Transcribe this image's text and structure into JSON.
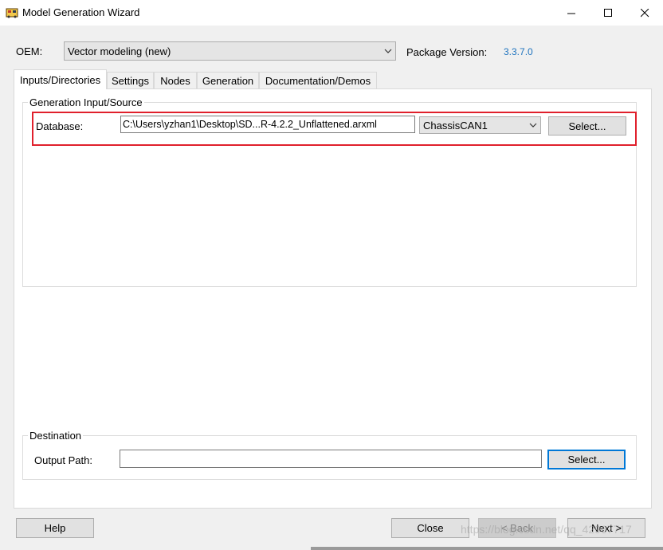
{
  "window": {
    "title": "Model Generation Wizard",
    "minimize_glyph": "—",
    "maximize_glyph": "☐",
    "close_glyph": "✕"
  },
  "oem": {
    "label": "OEM:",
    "value": "Vector modeling (new)",
    "package_version_label": "Package Version:",
    "package_version_value": "3.3.7.0"
  },
  "tabs": [
    {
      "label": "Inputs/Directories",
      "active": true
    },
    {
      "label": "Settings",
      "active": false
    },
    {
      "label": "Nodes",
      "active": false
    },
    {
      "label": "Generation",
      "active": false
    },
    {
      "label": "Documentation/Demos",
      "active": false
    }
  ],
  "generation_input": {
    "group_label": "Generation Input/Source",
    "database_label": "Database:",
    "database_path": "C:\\Users\\yzhan1\\Desktop\\SD...R-4.2.2_Unflattened.arxml",
    "channel_value": "ChassisCAN1",
    "select_label": "Select..."
  },
  "destination": {
    "group_label": "Destination",
    "output_path_label": "Output Path:",
    "output_path_value": "",
    "select_label": "Select..."
  },
  "footer": {
    "help_label": "Help",
    "close_label": "Close",
    "back_label": "< Back",
    "next_label": "Next >"
  },
  "watermark": "https://blog.csdn.net/qq_42967717",
  "colors": {
    "highlight_border": "#e0202c",
    "version_text": "#1e73be",
    "focus_border": "#0078d7"
  }
}
